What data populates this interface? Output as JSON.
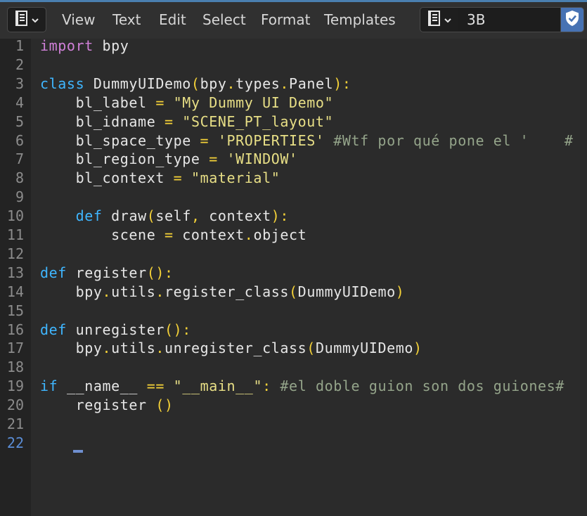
{
  "header": {
    "menus": [
      "View",
      "Text",
      "Edit",
      "Select",
      "Format",
      "Templates"
    ],
    "text_name": "3B"
  },
  "icons": {
    "editor_type": "text-editor-icon",
    "datablock": "text-datablock-icon",
    "dropdown": "chevron-down-icon",
    "fake_user": "shield-check-icon"
  },
  "colors": {
    "accent": "#4772b3",
    "keyword": "#3fb6ff",
    "import": "#d080d8",
    "operator": "#f5d238",
    "string": "#e8df86",
    "comment": "#94a48a"
  },
  "editor": {
    "current_line": 22,
    "line_numbers": [
      "1",
      "2",
      "3",
      "4",
      "5",
      "6",
      "7",
      "8",
      "9",
      "10",
      "11",
      "12",
      "13",
      "14",
      "15",
      "16",
      "17",
      "18",
      "19",
      "20",
      "21",
      "22"
    ],
    "lines": [
      [
        {
          "t": "kw-imp",
          "v": "import"
        },
        {
          "t": "",
          "v": " bpy"
        }
      ],
      [],
      [
        {
          "t": "kw",
          "v": "class"
        },
        {
          "t": "",
          "v": " DummyUIDemo"
        },
        {
          "t": "op",
          "v": "("
        },
        {
          "t": "",
          "v": "bpy"
        },
        {
          "t": "op",
          "v": "."
        },
        {
          "t": "",
          "v": "types"
        },
        {
          "t": "op",
          "v": "."
        },
        {
          "t": "",
          "v": "Panel"
        },
        {
          "t": "op",
          "v": "):"
        }
      ],
      [
        {
          "t": "",
          "v": "    bl_label "
        },
        {
          "t": "op",
          "v": "="
        },
        {
          "t": "",
          "v": " "
        },
        {
          "t": "str",
          "v": "\"My Dummy UI Demo\""
        }
      ],
      [
        {
          "t": "",
          "v": "    bl_idname "
        },
        {
          "t": "op",
          "v": "="
        },
        {
          "t": "",
          "v": " "
        },
        {
          "t": "str",
          "v": "\"SCENE_PT_layout\""
        }
      ],
      [
        {
          "t": "",
          "v": "    bl_space_type "
        },
        {
          "t": "op",
          "v": "="
        },
        {
          "t": "",
          "v": " "
        },
        {
          "t": "str",
          "v": "'PROPERTIES'"
        },
        {
          "t": "",
          "v": " "
        },
        {
          "t": "cmt",
          "v": "#Wtf por qué pone el '    #"
        }
      ],
      [
        {
          "t": "",
          "v": "    bl_region_type "
        },
        {
          "t": "op",
          "v": "="
        },
        {
          "t": "",
          "v": " "
        },
        {
          "t": "str",
          "v": "'WINDOW'"
        }
      ],
      [
        {
          "t": "",
          "v": "    bl_context "
        },
        {
          "t": "op",
          "v": "="
        },
        {
          "t": "",
          "v": " "
        },
        {
          "t": "str",
          "v": "\"material\""
        }
      ],
      [],
      [
        {
          "t": "",
          "v": "    "
        },
        {
          "t": "kw",
          "v": "def"
        },
        {
          "t": "",
          "v": " draw"
        },
        {
          "t": "op",
          "v": "("
        },
        {
          "t": "",
          "v": "self"
        },
        {
          "t": "op",
          "v": ","
        },
        {
          "t": "",
          "v": " context"
        },
        {
          "t": "op",
          "v": "):"
        }
      ],
      [
        {
          "t": "",
          "v": "        scene "
        },
        {
          "t": "op",
          "v": "="
        },
        {
          "t": "",
          "v": " context"
        },
        {
          "t": "op",
          "v": "."
        },
        {
          "t": "",
          "v": "object"
        }
      ],
      [],
      [
        {
          "t": "kw",
          "v": "def"
        },
        {
          "t": "",
          "v": " register"
        },
        {
          "t": "op",
          "v": "():"
        }
      ],
      [
        {
          "t": "",
          "v": "    bpy"
        },
        {
          "t": "op",
          "v": "."
        },
        {
          "t": "",
          "v": "utils"
        },
        {
          "t": "op",
          "v": "."
        },
        {
          "t": "",
          "v": "register_class"
        },
        {
          "t": "op",
          "v": "("
        },
        {
          "t": "",
          "v": "DummyUIDemo"
        },
        {
          "t": "op",
          "v": ")"
        }
      ],
      [],
      [
        {
          "t": "kw",
          "v": "def"
        },
        {
          "t": "",
          "v": " unregister"
        },
        {
          "t": "op",
          "v": "():"
        }
      ],
      [
        {
          "t": "",
          "v": "    bpy"
        },
        {
          "t": "op",
          "v": "."
        },
        {
          "t": "",
          "v": "utils"
        },
        {
          "t": "op",
          "v": "."
        },
        {
          "t": "",
          "v": "unregister_class"
        },
        {
          "t": "op",
          "v": "("
        },
        {
          "t": "",
          "v": "DummyUIDemo"
        },
        {
          "t": "op",
          "v": ")"
        }
      ],
      [],
      [
        {
          "t": "kw",
          "v": "if"
        },
        {
          "t": "",
          "v": " __name__ "
        },
        {
          "t": "op",
          "v": "=="
        },
        {
          "t": "",
          "v": " "
        },
        {
          "t": "str",
          "v": "\"__main__\""
        },
        {
          "t": "op",
          "v": ":"
        },
        {
          "t": "",
          "v": " "
        },
        {
          "t": "cmt",
          "v": "#el doble guion son dos guiones#"
        }
      ],
      [
        {
          "t": "",
          "v": "    register "
        },
        {
          "t": "op",
          "v": "()"
        }
      ],
      [],
      []
    ]
  }
}
